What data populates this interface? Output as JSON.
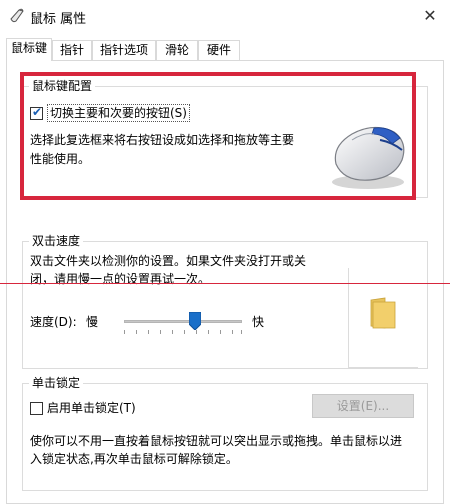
{
  "window": {
    "title": "鼠标 属性",
    "close_glyph": "✕"
  },
  "tabs": [
    {
      "label": "鼠标键"
    },
    {
      "label": "指针"
    },
    {
      "label": "指针选项"
    },
    {
      "label": "滑轮"
    },
    {
      "label": "硬件"
    }
  ],
  "button_config": {
    "title": "鼠标键配置",
    "checkbox_label": "切换主要和次要的按钮(S)",
    "checked": true,
    "description_line1": "选择此复选框来将右按钮设成如选择和拖放等主要",
    "description_line2": "性能使用。"
  },
  "double_click": {
    "title": "双击速度",
    "description_line1": "双击文件夹以检测你的设置。如果文件夹没打开或关",
    "description_line2": "闭，请用慢一点的设置再试一次。",
    "speed_label": "速度(D):",
    "slow_label": "慢",
    "fast_label": "快",
    "speed_level_fraction": 0.55
  },
  "click_lock": {
    "title": "单击锁定",
    "checkbox_label": "启用单击锁定(T)",
    "checked": false,
    "settings_button": "设置(E)...",
    "description_line1": "使你可以不用一直按着鼠标按钮就可以突出显示或拖拽。单击鼠标以进",
    "description_line2": "入锁定状态,再次单击鼠标可解除锁定。"
  },
  "colors": {
    "highlight_annotation": "#d7263d",
    "check_accent": "#1a5fb4",
    "slider_thumb": "#1a6fc9",
    "folder": "#f2cf6b"
  }
}
